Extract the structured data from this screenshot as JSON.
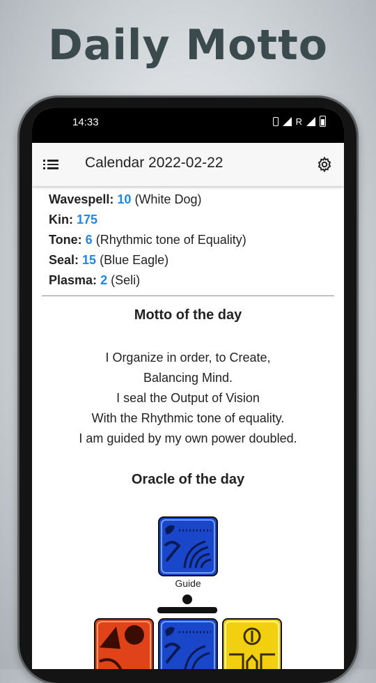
{
  "promo": {
    "title": "Daily Motto"
  },
  "status_bar": {
    "time": "14:33",
    "network_label": "R"
  },
  "app_bar": {
    "title": "Calendar 2022-02-22"
  },
  "info": {
    "wavespell": {
      "label": "Wavespell:",
      "value": "10",
      "note": "(White Dog)"
    },
    "kin": {
      "label": "Kin:",
      "value": "175"
    },
    "tone": {
      "label": "Tone:",
      "value": "6",
      "note": "(Rhythmic tone of Equality)"
    },
    "seal": {
      "label": "Seal:",
      "value": "15",
      "note": "(Blue Eagle)"
    },
    "plasma": {
      "label": "Plasma:",
      "value": "2",
      "note": "(Seli)"
    }
  },
  "motto": {
    "title": "Motto of the day",
    "lines": [
      "I Organize in order, to Create,",
      "Balancing Mind.",
      "I seal the Output of Vision",
      "With the Rhythmic tone of equality.",
      "I am guided by my own power doubled."
    ]
  },
  "oracle": {
    "title": "Oracle of the day",
    "guide_label": "Guide",
    "glyphs": [
      {
        "role": "guide",
        "icon": "blue-eagle-glyph",
        "color": "#1a47c9"
      },
      {
        "role": "antipode",
        "icon": "red-earth-glyph",
        "color": "#e0431a"
      },
      {
        "role": "destiny",
        "icon": "blue-eagle-glyph",
        "color": "#1a47c9"
      },
      {
        "role": "analog",
        "icon": "yellow-warrior-glyph",
        "color": "#f2cf0f"
      }
    ]
  },
  "colors": {
    "accent_number": "#1e88e5",
    "promo_title": "#3b4a4d"
  }
}
